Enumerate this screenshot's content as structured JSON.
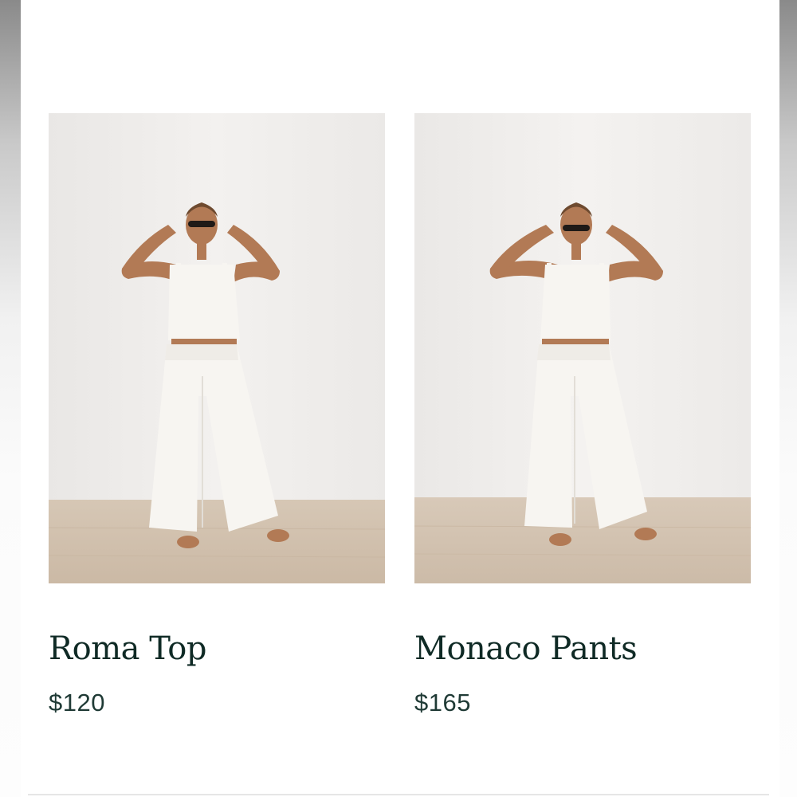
{
  "products": [
    {
      "name": "Roma Top",
      "price": "$120",
      "image_icon": "model-white-linen-set-photo"
    },
    {
      "name": "Monaco Pants",
      "price": "$165",
      "image_icon": "model-white-linen-set-photo"
    }
  ],
  "colors": {
    "title": "#0f2a25",
    "price": "#1f3a35",
    "wall": "#efedeb",
    "floor": "#d9cbbb",
    "garment": "#f7f5f1",
    "skin": "#b27a55"
  }
}
